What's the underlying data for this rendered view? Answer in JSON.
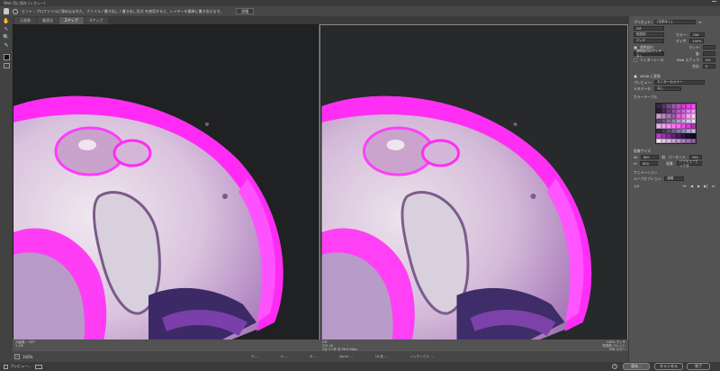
{
  "window": {
    "title": "Web 用に保存 (レガシー)"
  },
  "infobar": {
    "hint": "ヒント : プロファイルに埋め込まれた、ファイル / 書き出し / 書き出し形式 を使用すると、レイヤーを簡単に書き出せます。",
    "button": "詳細"
  },
  "tabs": [
    "元画像",
    "最適化",
    "2アップ",
    "4アップ"
  ],
  "active_tab": 2,
  "views": {
    "left": {
      "line1": "元画像 : \"GIF\"",
      "line2": "1.1M"
    },
    "right": {
      "line1": "GIF",
      "line2": "221.1K",
      "line3": "2分 17 秒 @ 56.6 Kbps",
      "r1": "100% ディザ",
      "r2": "知覚的 パレット",
      "r3": "256 カラー"
    }
  },
  "zoombar": {
    "zoom": "100%",
    "stats": [
      "R : --",
      "G : --",
      "B : --",
      "Alpha : --",
      "16 進 : --",
      "インデックス : --"
    ]
  },
  "footer": {
    "preview_label": "プレビュー...",
    "save_label": "保存...",
    "cancel_label": "キャンセル",
    "done_label": "完了",
    "help": "?"
  },
  "panel": {
    "preset_label": "プリセット:",
    "preset_value": "[名前なし]",
    "format_value": "GIF",
    "reduction_value": "知覚的",
    "colors_label": "カラー:",
    "colors_value": "256",
    "dither_value": "ディザ",
    "dither_label": "ディザ:",
    "dither_amount": "100%",
    "transparency_label": "透明部分",
    "matte_label": "マット:",
    "no_transparency_dither": "透明部分のディザなし",
    "amount_label": "量:",
    "interlace_label": "インターレース",
    "web_snap_label": "Web スナップ:",
    "web_snap_value": "0%",
    "lossy_label": "劣化:",
    "lossy_value": "0",
    "srgb_label": "sRGB に変換",
    "preview_label": "プレビュー:",
    "preview_value": "モニターのカラー",
    "metadata_label": "メタデータ:",
    "metadata_value": "なし",
    "color_table_label": "カラーテーブル",
    "image_size_label": "画像サイズ",
    "w_label": "W:",
    "w_value": "800",
    "h_label": "H:",
    "h_value": "800",
    "percent_label": "パーセント:",
    "percent_value": "100",
    "quality_label": "画質:",
    "quality_value": "バイキュービック法",
    "animation_label": "アニメーション",
    "loop_label": "ループオプション:",
    "loop_value": "無限",
    "frame_counter": "1/5"
  },
  "palette": {
    "colors": [
      "#3a2a44",
      "#5b3a6a",
      "#7a4d8a",
      "#9b5ea8",
      "#c14fc0",
      "#e23adf",
      "#f03bf0",
      "#ff4cff",
      "#2a2030",
      "#4a2c58",
      "#6d3e80",
      "#8f54a0",
      "#b15fbf",
      "#d268d6",
      "#e882e8",
      "#f49af4",
      "#c8a3c9",
      "#b98bc0",
      "#a774b6",
      "#9560ab",
      "#e05ddf",
      "#f070ef",
      "#ffa2ff",
      "#ffd0ff",
      "#5a4a68",
      "#6f5c80",
      "#837197",
      "#9a87ad",
      "#b09cc2",
      "#c6b2d6",
      "#dbc8e8",
      "#efe0f6",
      "#e9b5e6",
      "#f2a5ee",
      "#fb8ff6",
      "#ff7cfb",
      "#ff66f8",
      "#f250ec",
      "#d93fd6",
      "#b833b9",
      "#2f3040",
      "#404357",
      "#53566e",
      "#676b85",
      "#7b7f9b",
      "#9094b0",
      "#a6a9c4",
      "#bcbed6",
      "#c23fc7",
      "#a236b0",
      "#842c97",
      "#66247d",
      "#4a1b62",
      "#321447",
      "#1f0e30",
      "#110a1c",
      "#f3e6f4",
      "#e6d2ea",
      "#d8bedf",
      "#caaad3",
      "#bc97c8",
      "#ae84bc",
      "#a072b0",
      "#9262a4"
    ]
  }
}
